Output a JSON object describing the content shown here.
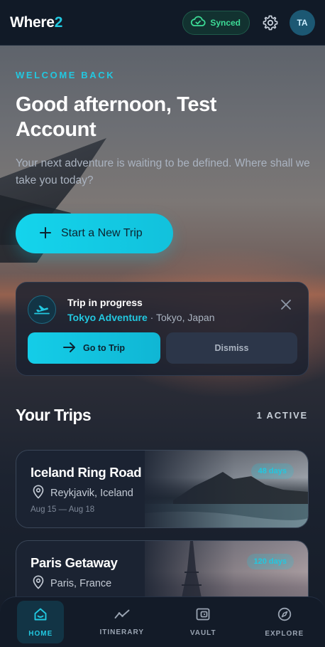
{
  "app": {
    "logo_main": "Where",
    "logo_accent": "2",
    "sync_status": "Synced",
    "avatar_initials": "TA"
  },
  "hero": {
    "eyebrow": "WELCOME BACK",
    "greeting": "Good afternoon, Test Account",
    "subtitle": "Your next adventure is waiting to be defined. Where shall we take you today?",
    "cta_label": "Start a New Trip"
  },
  "progress_card": {
    "title": "Trip in progress",
    "trip_name": "Tokyo Adventure",
    "separator": " · ",
    "location": "Tokyo, Japan",
    "goto_label": "Go to Trip",
    "dismiss_label": "Dismiss"
  },
  "trips": {
    "title": "Your Trips",
    "count_label": "1 ACTIVE",
    "items": [
      {
        "name": "Iceland Ring Road",
        "location": "Reykjavik, Iceland",
        "dates": "Aug 15 — Aug 18",
        "badge": "48 days"
      },
      {
        "name": "Paris Getaway",
        "location": "Paris, France",
        "dates": "",
        "badge": "120 days"
      }
    ]
  },
  "nav": {
    "items": [
      {
        "label": "HOME",
        "icon": "home-icon",
        "active": true
      },
      {
        "label": "ITINERARY",
        "icon": "trend-icon",
        "active": false
      },
      {
        "label": "VAULT",
        "icon": "wallet-icon",
        "active": false
      },
      {
        "label": "EXPLORE",
        "icon": "compass-icon",
        "active": false
      }
    ]
  },
  "colors": {
    "accent": "#22c8e0",
    "synced": "#3ddc97",
    "background": "#0f1724"
  }
}
